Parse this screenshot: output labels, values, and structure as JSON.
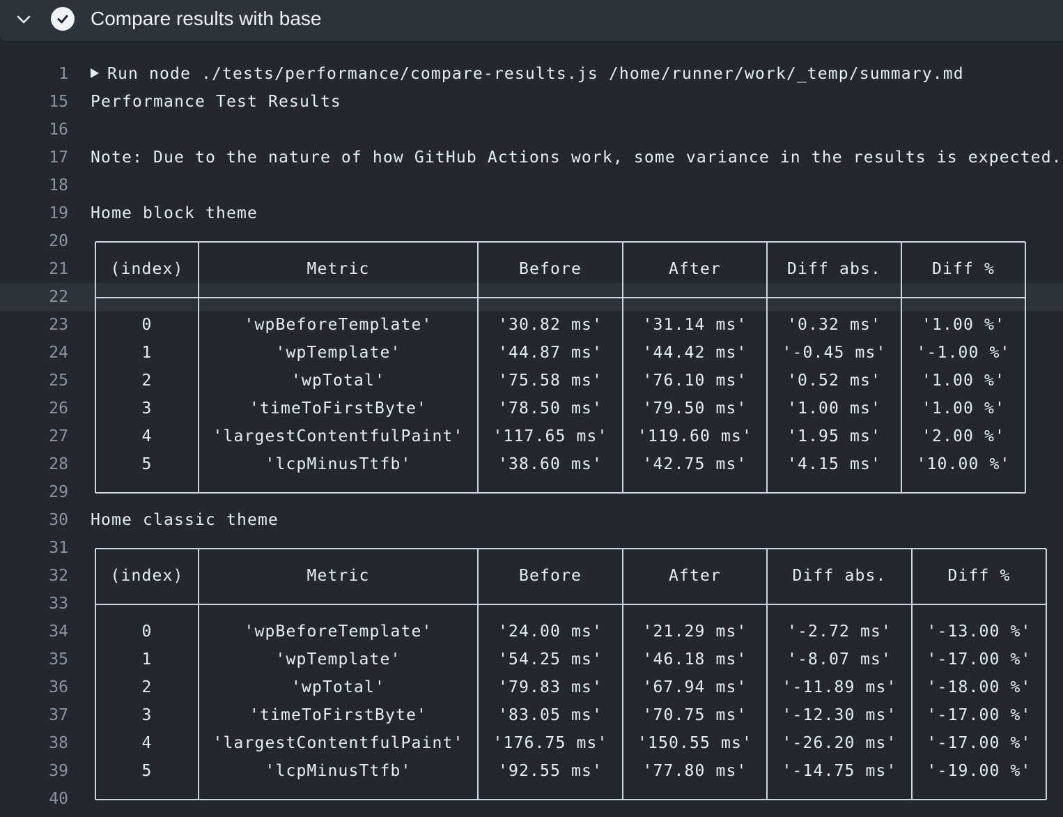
{
  "step": {
    "title": "Compare results with base",
    "status_icon": "check-circle-icon",
    "collapse_icon": "chevron-down-icon"
  },
  "lines": [
    {
      "num": "1",
      "text": "Run node ./tests/performance/compare-results.js /home/runner/work/_temp/summary.md",
      "run": true
    },
    {
      "num": "15",
      "text": "Performance Test Results"
    },
    {
      "num": "16",
      "text": ""
    },
    {
      "num": "17",
      "text": "Note: Due to the nature of how GitHub Actions work, some variance in the results is expected."
    },
    {
      "num": "18",
      "text": ""
    },
    {
      "num": "19",
      "text": "Home block theme"
    },
    {
      "num": "20",
      "text": ""
    },
    {
      "num": "21",
      "text": ""
    },
    {
      "num": "22",
      "text": ""
    },
    {
      "num": "23",
      "text": ""
    },
    {
      "num": "24",
      "text": ""
    },
    {
      "num": "25",
      "text": ""
    },
    {
      "num": "26",
      "text": ""
    },
    {
      "num": "27",
      "text": ""
    },
    {
      "num": "28",
      "text": ""
    },
    {
      "num": "29",
      "text": ""
    },
    {
      "num": "30",
      "text": "Home classic theme"
    },
    {
      "num": "31",
      "text": ""
    },
    {
      "num": "32",
      "text": ""
    },
    {
      "num": "33",
      "text": ""
    },
    {
      "num": "34",
      "text": ""
    },
    {
      "num": "35",
      "text": ""
    },
    {
      "num": "36",
      "text": ""
    },
    {
      "num": "37",
      "text": ""
    },
    {
      "num": "38",
      "text": ""
    },
    {
      "num": "39",
      "text": ""
    },
    {
      "num": "40",
      "text": ""
    }
  ],
  "highlighted_line": "22",
  "tables": [
    {
      "name": "Home block theme",
      "headers": [
        "(index)",
        "Metric",
        "Before",
        "After",
        "Diff abs.",
        "Diff %"
      ],
      "rows": [
        [
          "0",
          "'wpBeforeTemplate'",
          "'30.82 ms'",
          "'31.14 ms'",
          "'0.32 ms'",
          "'1.00 %'"
        ],
        [
          "1",
          "'wpTemplate'",
          "'44.87 ms'",
          "'44.42 ms'",
          "'-0.45 ms'",
          "'-1.00 %'"
        ],
        [
          "2",
          "'wpTotal'",
          "'75.58 ms'",
          "'76.10 ms'",
          "'0.52 ms'",
          "'1.00 %'"
        ],
        [
          "3",
          "'timeToFirstByte'",
          "'78.50 ms'",
          "'79.50 ms'",
          "'1.00 ms'",
          "'1.00 %'"
        ],
        [
          "4",
          "'largestContentfulPaint'",
          "'117.65 ms'",
          "'119.60 ms'",
          "'1.95 ms'",
          "'2.00 %'"
        ],
        [
          "5",
          "'lcpMinusTtfb'",
          "'38.60 ms'",
          "'42.75 ms'",
          "'4.15 ms'",
          "'10.00 %'"
        ]
      ]
    },
    {
      "name": "Home classic theme",
      "headers": [
        "(index)",
        "Metric",
        "Before",
        "After",
        "Diff abs.",
        "Diff %"
      ],
      "rows": [
        [
          "0",
          "'wpBeforeTemplate'",
          "'24.00 ms'",
          "'21.29 ms'",
          "'-2.72 ms'",
          "'-13.00 %'"
        ],
        [
          "1",
          "'wpTemplate'",
          "'54.25 ms'",
          "'46.18 ms'",
          "'-8.07 ms'",
          "'-17.00 %'"
        ],
        [
          "2",
          "'wpTotal'",
          "'79.83 ms'",
          "'67.94 ms'",
          "'-11.89 ms'",
          "'-18.00 %'"
        ],
        [
          "3",
          "'timeToFirstByte'",
          "'83.05 ms'",
          "'70.75 ms'",
          "'-12.30 ms'",
          "'-17.00 %'"
        ],
        [
          "4",
          "'largestContentfulPaint'",
          "'176.75 ms'",
          "'150.55 ms'",
          "'-26.20 ms'",
          "'-17.00 %'"
        ],
        [
          "5",
          "'lcpMinusTtfb'",
          "'92.55 ms'",
          "'77.80 ms'",
          "'-14.75 ms'",
          "'-19.00 %'"
        ]
      ]
    }
  ],
  "colors": {
    "background": "#23272f",
    "header_bg": "#2d333b",
    "text": "#e6edf3",
    "line_number": "#8b949e",
    "table_border": "#cdd5de"
  }
}
